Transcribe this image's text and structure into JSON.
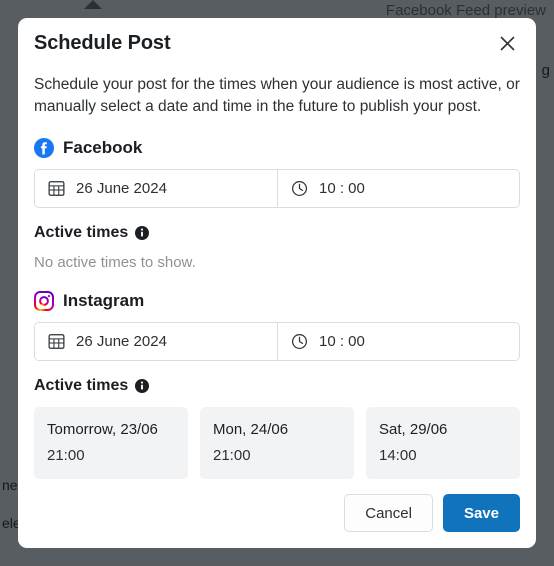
{
  "background": {
    "preview_label": "Facebook Feed preview",
    "left_text_1": "ne",
    "left_text_2": "ele",
    "right_text": "g"
  },
  "modal": {
    "title": "Schedule Post",
    "close_label": "×",
    "description": "Schedule your post for the times when your audience is most active, or manually select a date and time in the future to publish your post.",
    "sections": [
      {
        "network": "Facebook",
        "network_icon": "facebook-icon",
        "date_value": "26 June 2024",
        "date_icon": "calendar-icon",
        "time_value": "10 : 00",
        "time_icon": "clock-icon",
        "active_times_label": "Active times",
        "info_icon": "info-icon",
        "empty_message": "No active times to show.",
        "cards": []
      },
      {
        "network": "Instagram",
        "network_icon": "instagram-icon",
        "date_value": "26 June 2024",
        "date_icon": "calendar-icon",
        "time_value": "10 : 00",
        "time_icon": "clock-icon",
        "active_times_label": "Active times",
        "info_icon": "info-icon",
        "empty_message": "",
        "cards": [
          {
            "date": "Tomorrow, 23/06",
            "hour": "21:00"
          },
          {
            "date": "Mon, 24/06",
            "hour": "21:00"
          },
          {
            "date": "Sat, 29/06",
            "hour": "14:00"
          }
        ]
      }
    ],
    "footer": {
      "cancel_label": "Cancel",
      "save_label": "Save"
    }
  },
  "colors": {
    "primary": "#1273bd",
    "text": "#1b1f23",
    "muted": "#8d9296",
    "border": "#d9dde0",
    "card_bg": "#f2f3f4",
    "overlay": "#585d61"
  }
}
